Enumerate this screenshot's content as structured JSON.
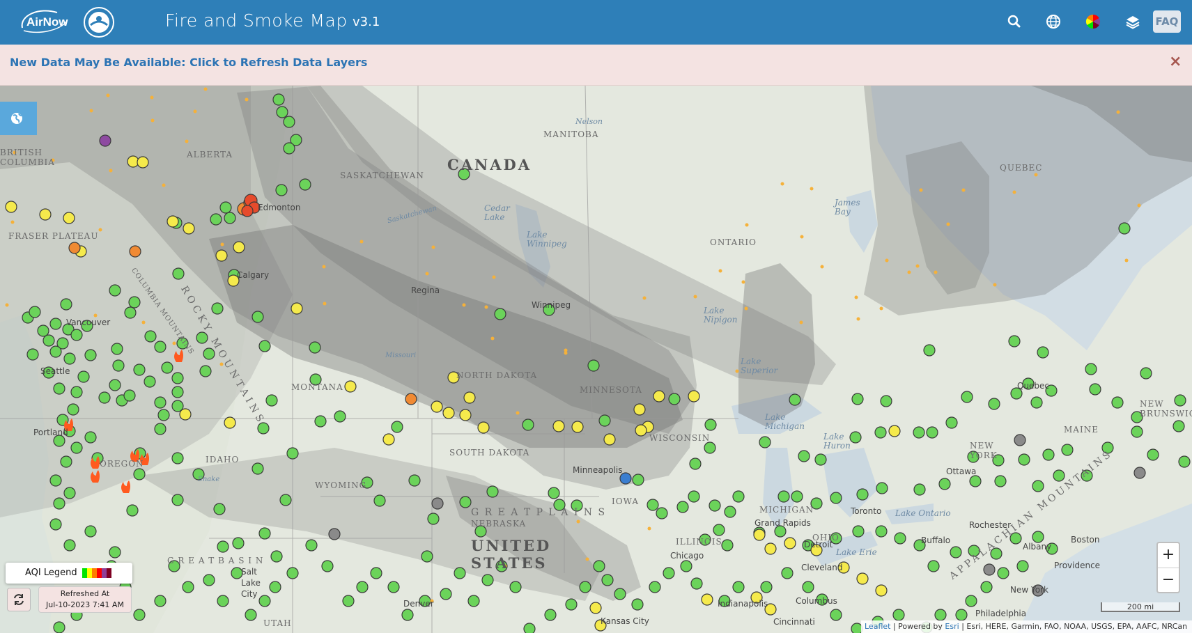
{
  "header": {
    "logo_text": "AirNow",
    "title": "Fire and Smoke Map",
    "version": "v3.1",
    "icons": [
      "search-icon",
      "globe-icon",
      "color-wheel-icon",
      "layers-icon"
    ],
    "faq_label": "FAQ"
  },
  "notice": {
    "text": "New Data May Be Available: Click to Refresh Data Layers",
    "close_label": "×"
  },
  "map": {
    "labels": {
      "canada": "CANADA",
      "united_states": "UNITED STATES",
      "great_plains": "G R E A T   P L A I N S",
      "great_basin": "G R E A T   B A S I N",
      "british_columbia": "BRITISH COLUMBIA",
      "alberta": "ALBERTA",
      "saskatchewan": "SASKATCHEWAN",
      "manitoba": "MANITOBA",
      "ontario": "ONTARIO",
      "quebec": "QUEBEC",
      "montana": "MONTANA",
      "idaho": "IDAHO",
      "oregon": "OREGON",
      "wyoming": "WYOMING",
      "utah": "UTAH",
      "nebraska": "NEBRASKA",
      "iowa": "IOWA",
      "illinois": "ILLINOIS",
      "north_dakota": "NORTH DAKOTA",
      "south_dakota": "SOUTH DAKOTA",
      "minnesota": "MINNESOTA",
      "wisconsin": "WISCONSIN",
      "michigan": "MICHIGAN",
      "ohio": "OHIO",
      "new_york": "NEW YORK",
      "maine": "MAINE",
      "new_brunswick": "NEW BRUNSWICK",
      "fraser_plateau": "FRASER PLATEAU",
      "columbia_mountains": "COLUMBIA MOUNTAINS",
      "rocky_mountains": "ROCKY MOUNTAINS",
      "appalachian": "APPALACHIAN MOUNTAINS",
      "nelson": "Nelson",
      "edmonton": "Edmonton",
      "calgary": "Calgary",
      "regina": "Regina",
      "winnipeg": "Winnipeg",
      "vancouver": "Vancouver",
      "seattle": "Seattle",
      "portland": "Portland",
      "minneapolis": "Minneapolis",
      "chicago": "Chicago",
      "grand_rapids": "Grand Rapids",
      "detroit": "Detroit",
      "cleveland": "Cleveland",
      "columbus": "Columbus",
      "toronto": "Toronto",
      "ottawa": "Ottawa",
      "buffalo": "Buffalo",
      "rochester": "Rochester",
      "albany": "Albany",
      "boston": "Boston",
      "providence": "Providence",
      "new_york_city": "New York",
      "philadelphia": "Philadelphia",
      "quebec_city": "Quebec",
      "denver": "Denver",
      "salt_lake": "Salt Lake City",
      "kansas_city": "Kansas City",
      "indianapolis": "Indianapolis",
      "cincinnati": "Cincinnati",
      "lake_winnipeg": "Lake Winnipeg",
      "cedar_lake": "Cedar Lake",
      "lake_nipigon": "Lake Nipigon",
      "lake_superior": "Lake Superior",
      "lake_michigan": "Lake Michigan",
      "lake_huron": "Lake Huron",
      "lake_ontario": "Lake Ontario",
      "lake_erie": "Lake Erie",
      "james_bay": "James Bay",
      "missouri": "Missouri",
      "saskatchewan_river": "Saskatchewan",
      "snake": "Snake"
    }
  },
  "legend": {
    "label": "AQI Legend",
    "colors": [
      "#00e400",
      "#ffff00",
      "#ff7e00",
      "#ff0000",
      "#8f3f97",
      "#7e0023"
    ]
  },
  "refresh": {
    "label": "Refreshed At",
    "timestamp": "Jul-10-2023 7:41 AM"
  },
  "scale": {
    "label": "200 mi"
  },
  "zoom": {
    "in_label": "+",
    "out_label": "−"
  },
  "attribution": {
    "leaflet": "Leaflet",
    "powered": "| Powered by",
    "esri": "Esri",
    "sources": "| Esri, HERE, Garmin, FAO, NOAA, USGS, EPA, AAFC, NRCan"
  }
}
